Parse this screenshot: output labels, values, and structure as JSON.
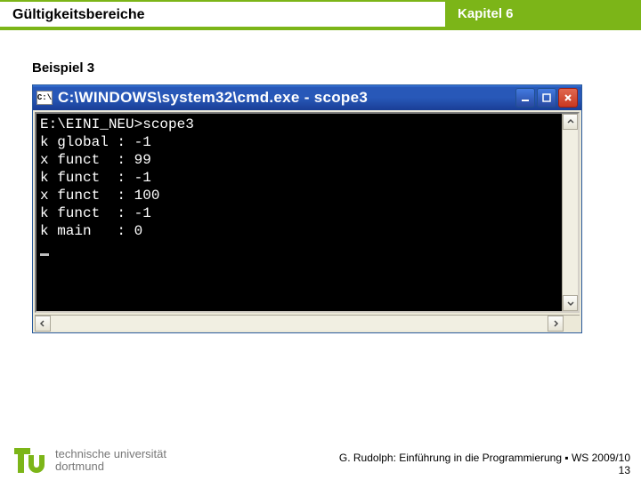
{
  "header": {
    "left": "Gültigkeitsbereiche",
    "right": "Kapitel 6"
  },
  "example_label": "Beispiel 3",
  "cmd_window": {
    "titlebar_icon_text": "C:\\",
    "title": "C:\\WINDOWS\\system32\\cmd.exe - scope3",
    "prompt_line": "E:\\EINI_NEU>scope3",
    "output_rows": [
      {
        "var": "k",
        "scope": "global",
        "value": "-1"
      },
      {
        "var": "x",
        "scope": "funct",
        "value": "99"
      },
      {
        "var": "k",
        "scope": "funct",
        "value": "-1"
      },
      {
        "var": "x",
        "scope": "funct",
        "value": "100"
      },
      {
        "var": "k",
        "scope": "funct",
        "value": "-1"
      },
      {
        "var": "k",
        "scope": "main",
        "value": "0"
      }
    ]
  },
  "footer": {
    "logo_line1": "technische universität",
    "logo_line2": "dortmund",
    "credit": "G. Rudolph: Einführung in die Programmierung ▪ WS 2009/10",
    "page": "13"
  }
}
